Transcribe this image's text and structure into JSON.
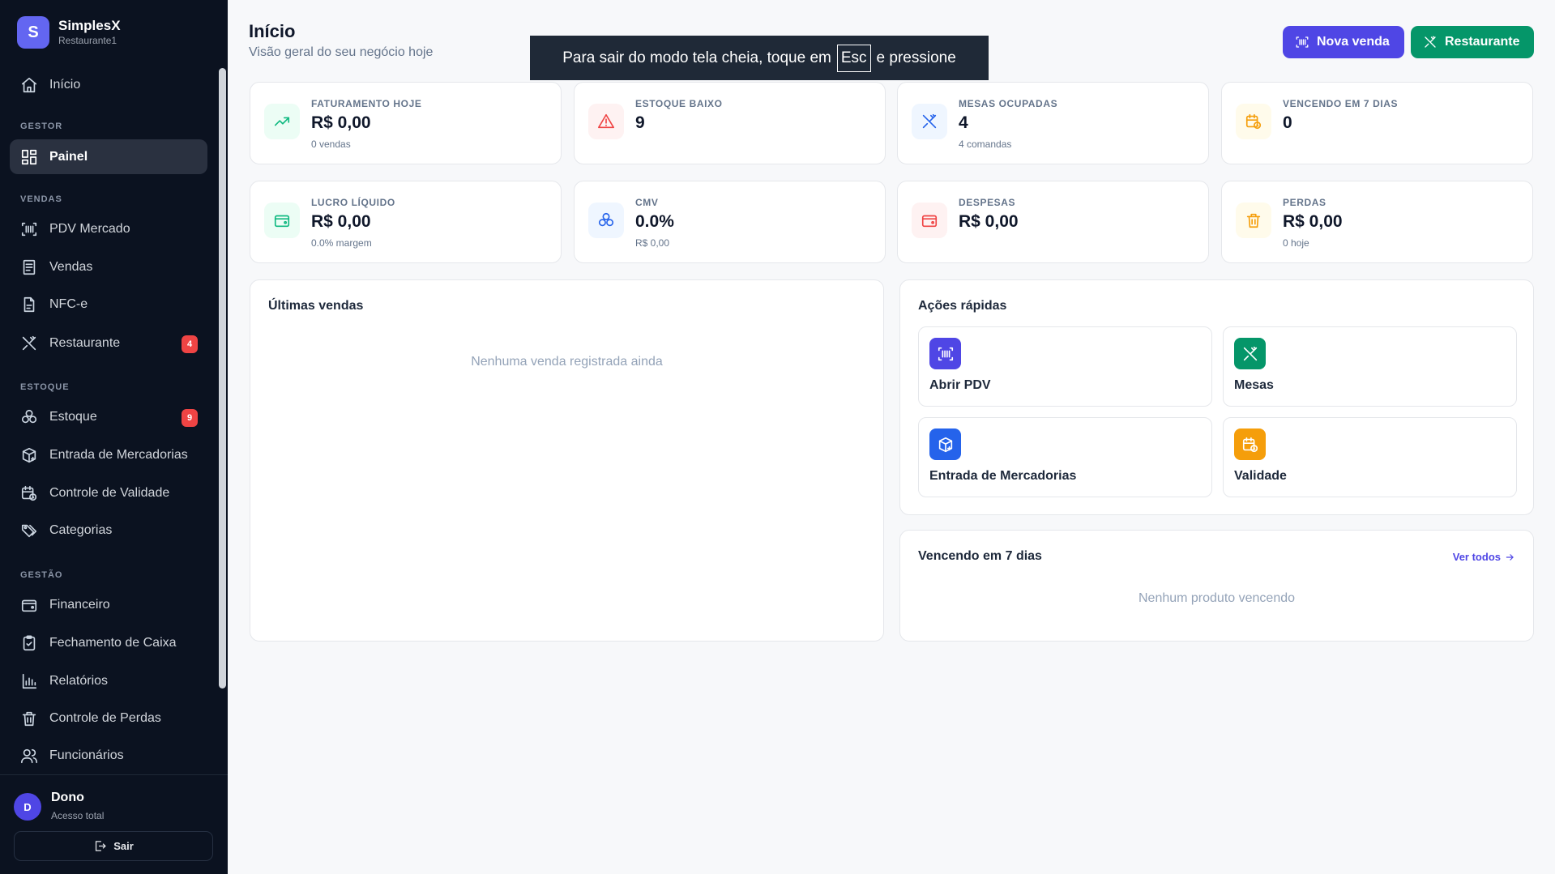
{
  "brand": {
    "initial": "S",
    "name": "SimplesX",
    "subtitle": "Restaurante1"
  },
  "colors": {
    "primary": "#4f46e5",
    "success": "#059669",
    "danger": "#ef4444",
    "sidebar": "#0b1220"
  },
  "nav": {
    "inicio": {
      "label": "Início",
      "icon": "home-icon"
    },
    "sections": {
      "gestor": "GESTOR",
      "vendas": "VENDAS",
      "estoque": "ESTOQUE",
      "gestao": "GESTÃO"
    },
    "painel": {
      "label": "Painel",
      "icon": "layout-grid-icon"
    },
    "pdv": {
      "label": "PDV Mercado",
      "icon": "barcode-scan-icon"
    },
    "vendas": {
      "label": "Vendas",
      "icon": "receipt-icon"
    },
    "nfce": {
      "label": "NFC-e",
      "icon": "file-document-icon"
    },
    "restaurante": {
      "label": "Restaurante",
      "badge": "4",
      "icon": "utensils-icon"
    },
    "estoque": {
      "label": "Estoque",
      "badge": "9",
      "icon": "boxes-icon"
    },
    "entrada": {
      "label": "Entrada de Mercadorias",
      "icon": "package-plus-icon"
    },
    "validade": {
      "label": "Controle de Validade",
      "icon": "calendar-clock-icon"
    },
    "categorias": {
      "label": "Categorias",
      "icon": "tags-icon"
    },
    "financeiro": {
      "label": "Financeiro",
      "icon": "wallet-icon"
    },
    "fechamento": {
      "label": "Fechamento de Caixa",
      "icon": "clipboard-check-icon"
    },
    "relatorios": {
      "label": "Relatórios",
      "icon": "bar-chart-icon"
    },
    "perdas": {
      "label": "Controle de Perdas",
      "icon": "trash-icon"
    },
    "funcionarios": {
      "label": "Funcionários",
      "icon": "users-icon"
    }
  },
  "user": {
    "initial": "D",
    "name": "Dono",
    "role": "Acesso total",
    "logout_label": "Sair"
  },
  "header": {
    "title": "Início",
    "subtitle": "Visão geral do seu negócio hoje",
    "btn_nova_venda": "Nova venda",
    "btn_restaurante": "Restaurante"
  },
  "toast": {
    "before": "Para sair do modo tela cheia, toque em",
    "key": "Esc",
    "after": "e pressione"
  },
  "stats": {
    "faturamento": {
      "label": "FATURAMENTO HOJE",
      "value": "R$ 0,00",
      "sub": "0 vendas",
      "icon": "trending-up-icon",
      "color": "#10b981"
    },
    "estoque_baixo": {
      "label": "ESTOQUE BAIXO",
      "value": "9",
      "icon": "alert-triangle-icon",
      "color": "#ef4444"
    },
    "mesas": {
      "label": "MESAS OCUPADAS",
      "value": "4",
      "sub": "4 comandas",
      "icon": "utensils-icon",
      "color": "#2563eb"
    },
    "vencendo": {
      "label": "VENCENDO EM 7 DIAS",
      "value": "0",
      "icon": "calendar-clock-icon",
      "color": "#f59e0b"
    },
    "lucro": {
      "label": "LUCRO LÍQUIDO",
      "value": "R$ 0,00",
      "sub": "0.0% margem",
      "icon": "wallet-icon",
      "color": "#10b981"
    },
    "cmv": {
      "label": "CMV",
      "value": "0.0%",
      "sub": "R$ 0,00",
      "icon": "boxes-icon",
      "color": "#2563eb"
    },
    "despesas": {
      "label": "DESPESAS",
      "value": "R$ 0,00",
      "icon": "wallet-icon",
      "color": "#ef4444"
    },
    "perdas": {
      "label": "PERDAS",
      "value": "R$ 0,00",
      "sub": "0 hoje",
      "icon": "trash-icon",
      "color": "#f59e0b"
    }
  },
  "ultimas_vendas": {
    "title": "Últimas vendas",
    "empty": "Nenhuma venda registrada ainda"
  },
  "acoes_rapidas": {
    "title": "Ações rápidas",
    "abrir_pdv": {
      "label": "Abrir PDV",
      "icon": "barcode-scan-icon",
      "color": "#4f46e5"
    },
    "mesas": {
      "label": "Mesas",
      "icon": "utensils-icon",
      "color": "#059669"
    },
    "entrada": {
      "label": "Entrada de Mercadorias",
      "icon": "package-plus-icon",
      "color": "#2563eb"
    },
    "validade": {
      "label": "Validade",
      "icon": "calendar-clock-icon",
      "color": "#f59e0b"
    }
  },
  "vencendo_panel": {
    "title": "Vencendo em 7 dias",
    "see_all": "Ver todos",
    "empty": "Nenhum produto vencendo"
  }
}
